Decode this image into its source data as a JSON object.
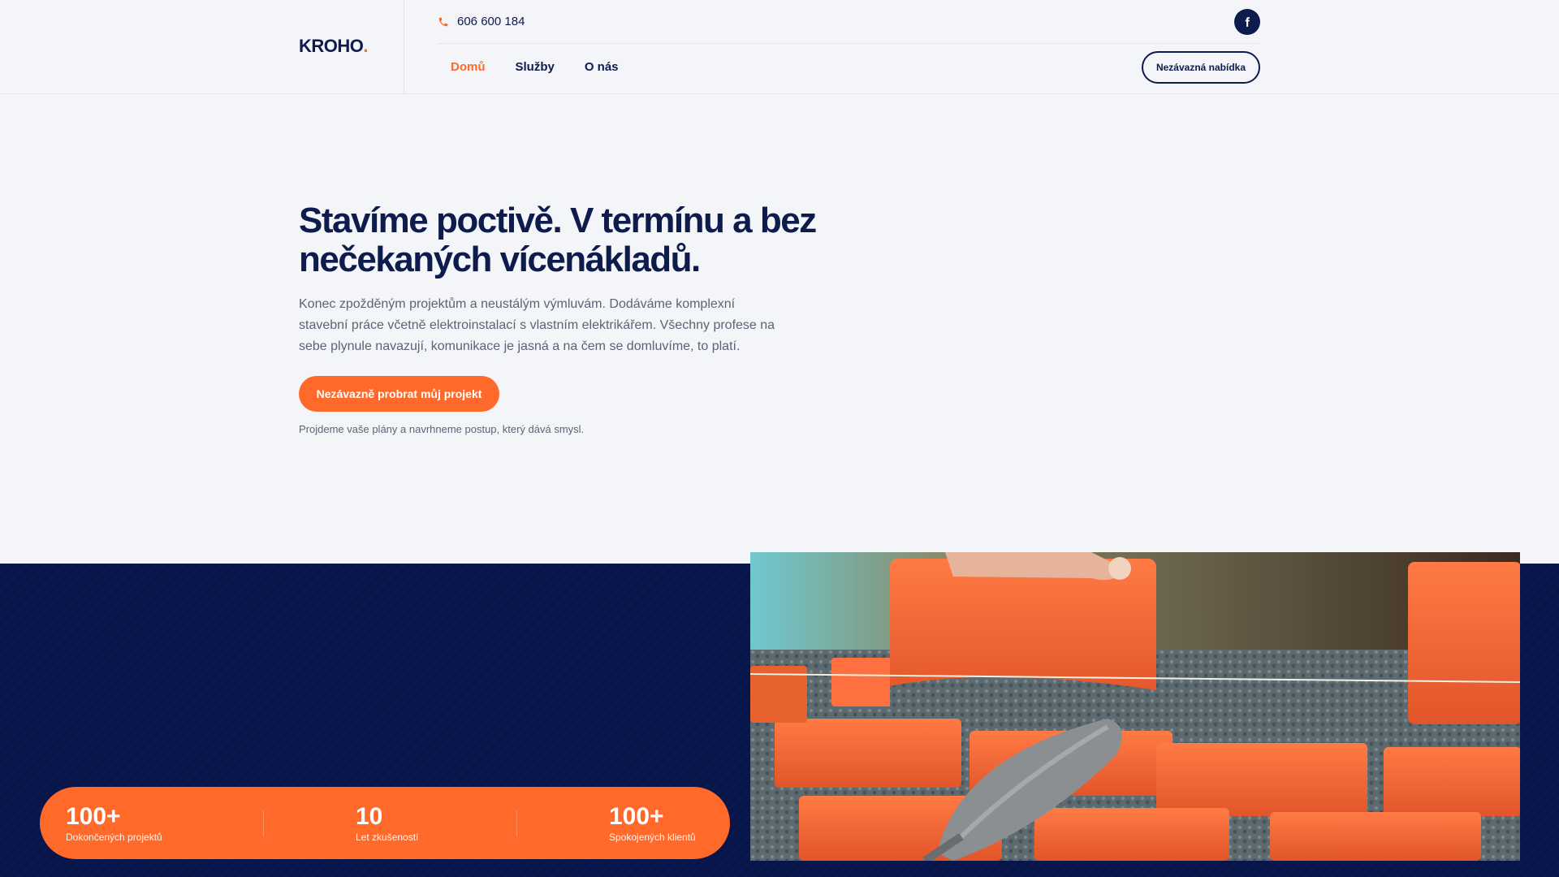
{
  "header": {
    "logo_text": "KROHO",
    "logo_dot": ".",
    "phone": "606 600 184",
    "nav": [
      {
        "label": "Domů",
        "active": true
      },
      {
        "label": "Služby",
        "active": false
      },
      {
        "label": "O nás",
        "active": false
      }
    ],
    "cta_label": "Nezávazná nabídka",
    "social_icon": "facebook-icon"
  },
  "hero": {
    "title": "Stavíme poctivě. V termínu a bez nečekaných vícenákladů.",
    "text": "Konec zpožděným projektům a neustálým výmluvám. Dodáváme komplexní stavební práce včetně elektroinstalací s vlastním elektrikářem. Všechny profese na sebe plynule navazují, komunikace je jasná a na čem se domluvíme, to platí.",
    "button_label": "Nezávazně probrat můj projekt",
    "note": "Projdeme vaše plány a navrhneme postup, který dává smysl."
  },
  "stats": [
    {
      "value": "100+",
      "label": "Dokončených projektů"
    },
    {
      "value": "10",
      "label": "Let zkušeností"
    },
    {
      "value": "100+",
      "label": "Spokojených klientů"
    }
  ],
  "colors": {
    "accent": "#ff6a2b",
    "navy": "#0d1b4d",
    "band": "#07154a"
  }
}
